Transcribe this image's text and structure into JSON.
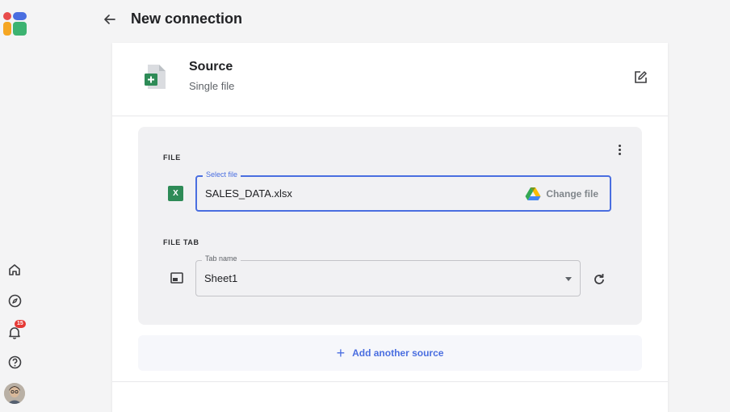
{
  "app": {
    "colors": {
      "accent": "#4a6ee0",
      "logo_red": "#e84b4b",
      "logo_blue": "#4a6ee0",
      "logo_orange": "#f5a623",
      "logo_green": "#3cb371"
    },
    "notification_count": "15"
  },
  "header": {
    "title": "New connection"
  },
  "source": {
    "title": "Source",
    "subtitle": "Single file"
  },
  "file_section": {
    "label": "FILE",
    "field_label": "Select file",
    "value": "SALES_DATA.xlsx",
    "file_icon_letter": "X",
    "change_label": "Change file"
  },
  "tab_section": {
    "label": "FILE TAB",
    "field_label": "Tab name",
    "value": "Sheet1"
  },
  "add_source": {
    "label": "Add another source",
    "icon": "+"
  },
  "icons": {
    "rail": [
      "home-icon",
      "compass-icon",
      "bell-icon",
      "help-icon"
    ],
    "header": [
      "back-arrow-icon"
    ],
    "card": [
      "spreadsheet-add-icon",
      "edit-icon",
      "kebab-menu-icon",
      "excel-icon",
      "google-drive-icon",
      "tab-icon",
      "refresh-icon",
      "dropdown-arrow-icon"
    ]
  }
}
